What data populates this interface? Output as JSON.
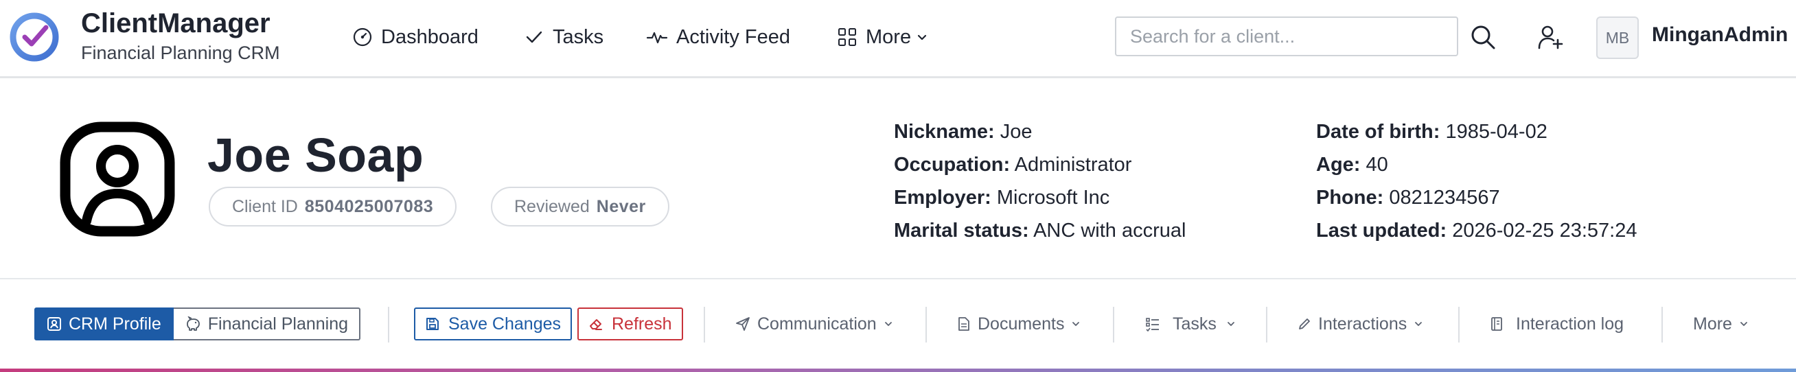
{
  "app": {
    "title": "ClientManager",
    "subtitle": "Financial Planning CRM",
    "logo_icon": "check-circle-logo"
  },
  "nav": {
    "items": [
      {
        "label": "Dashboard",
        "icon": "dashboard-gauge-icon"
      },
      {
        "label": "Tasks",
        "icon": "check-icon"
      },
      {
        "label": "Activity Feed",
        "icon": "activity-pulse-icon"
      },
      {
        "label": "More",
        "icon": "grid-icon"
      }
    ]
  },
  "search": {
    "placeholder": "Search for a client...",
    "value": ""
  },
  "user": {
    "initials": "MB",
    "name": "MinganAdmin"
  },
  "client": {
    "name": "Joe Soap",
    "client_id_label": "Client ID",
    "client_id": "8504025007083",
    "reviewed_label": "Reviewed",
    "reviewed": "Never",
    "details_left": [
      {
        "key": "Nickname:",
        "value": "Joe"
      },
      {
        "key": "Occupation:",
        "value": "Administrator"
      },
      {
        "key": "Employer:",
        "value": "Microsoft Inc"
      },
      {
        "key": "Marital status:",
        "value": "ANC with accrual"
      }
    ],
    "details_right": [
      {
        "key": "Date of birth:",
        "value": "1985-04-02"
      },
      {
        "key": "Age:",
        "value": "40"
      },
      {
        "key": "Phone:",
        "value": "0821234567"
      },
      {
        "key": "Last updated:",
        "value": "2026-02-25 23:57:24"
      }
    ]
  },
  "toolbar": {
    "tabs": [
      {
        "label": "CRM Profile",
        "active": true
      },
      {
        "label": "Financial Planning",
        "active": false
      }
    ],
    "save_label": "Save Changes",
    "refresh_label": "Refresh",
    "menus": [
      {
        "label": "Communication",
        "dropdown": true
      },
      {
        "label": "Documents",
        "dropdown": true
      },
      {
        "label": "Tasks",
        "dropdown": true
      },
      {
        "label": "Interactions",
        "dropdown": true
      },
      {
        "label": "Interaction log",
        "dropdown": false
      },
      {
        "label": "More",
        "dropdown": true
      }
    ]
  },
  "colors": {
    "primary": "#1d5ba6",
    "danger": "#c8323a",
    "logo_ring": "#4a7fd6",
    "logo_check": "#9b3fb5"
  }
}
